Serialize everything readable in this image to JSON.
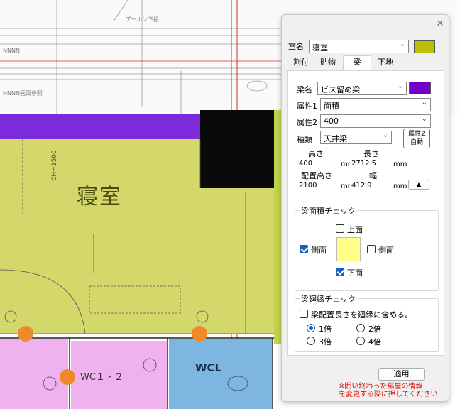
{
  "plan": {
    "room_name": "寝室",
    "wc12_label": "WC１・２",
    "wcl_label": "WCL",
    "dim_label": "CH=2500",
    "colors": {
      "bedroom": "#d4d86a",
      "beam": "#7b2bd9",
      "wc12": "#efb2ef",
      "wcl": "#7db6e0",
      "marker": "#ee8a2a"
    }
  },
  "dialog": {
    "close_icon": "close-icon",
    "room_label": "室名",
    "room_value": "寝室",
    "room_color": "#bcbf0a",
    "tabs": [
      {
        "label": "割付"
      },
      {
        "label": "貼物"
      },
      {
        "label": "梁"
      },
      {
        "label": "下地"
      }
    ],
    "active_tab": "梁",
    "beam": {
      "name_label": "梁名",
      "name_value": "ビス留め梁",
      "color": "#7000c8",
      "attr1_label": "属性1",
      "attr1_value": "面積",
      "attr2_label": "属性2",
      "attr2_value": "400",
      "type_label": "種類",
      "type_value": "天井梁",
      "auto_button_line1": "属性2",
      "auto_button_line2": "自動",
      "height_label": "高さ",
      "height_value": "400",
      "length_label": "長さ",
      "length_value": "2712.5",
      "place_height_label": "配置高さ",
      "place_height_value": "2100",
      "width_label": "幅",
      "width_value": "412.9",
      "unit": "mm",
      "up_button": "▲"
    },
    "area_check": {
      "title": "梁面積チェック",
      "top_label": "上面",
      "left_label": "側面",
      "right_label": "側面",
      "bottom_label": "下面",
      "preview_color": "#ffff88"
    },
    "perimeter_check": {
      "title": "梁廻縁チェック",
      "include_label": "梁配置長さを廻縁に含める。",
      "options": [
        "1倍",
        "2倍",
        "3倍",
        "4倍"
      ],
      "selected": "1倍"
    },
    "apply_button": "適用",
    "note_line1": "※囲い終わった部屋の情報",
    "note_line2": "を変更する際に押してください"
  }
}
